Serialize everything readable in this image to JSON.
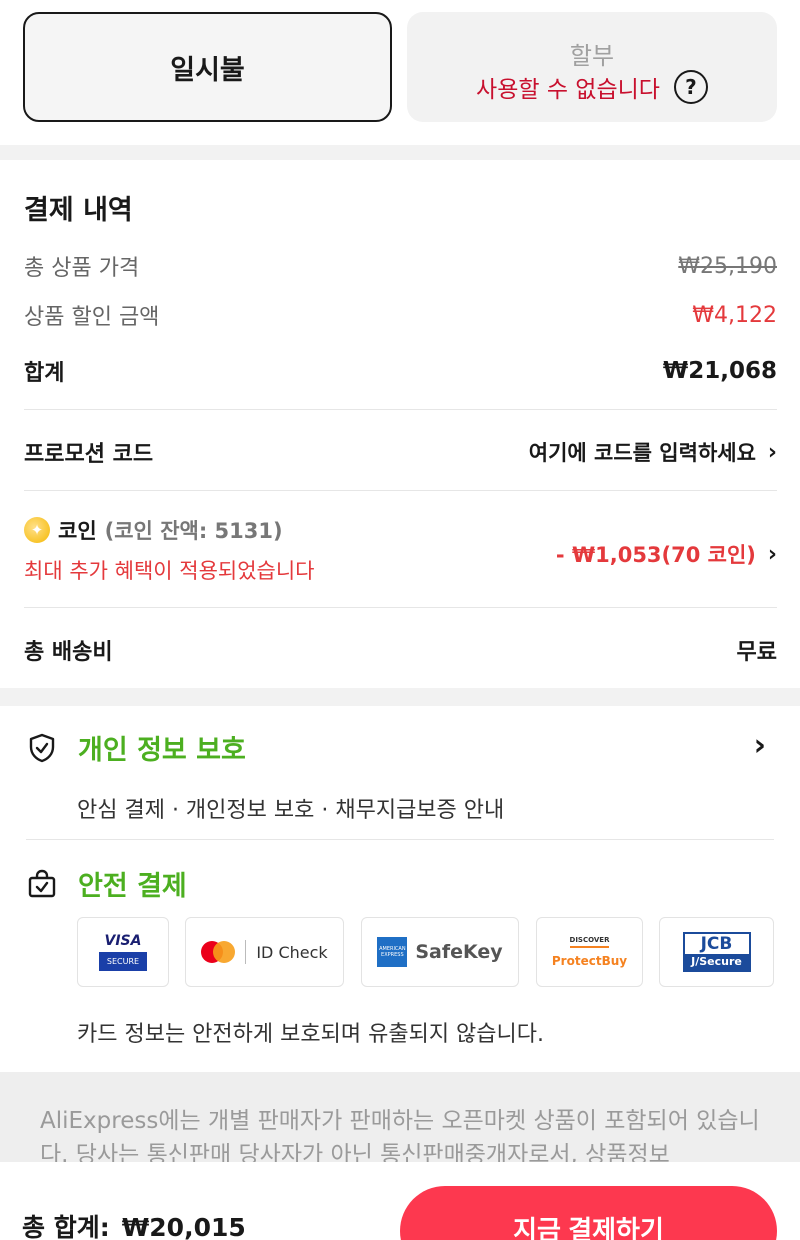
{
  "payment_type": {
    "lump_sum": "일시불",
    "installment": "할부",
    "installment_status": "사용할 수 없습니다",
    "help_icon": "question-circle-icon"
  },
  "summary": {
    "title": "결제 내역",
    "subtotal_label": "총 상품 가격",
    "subtotal_value": "₩25,190",
    "discount_label": "상품 할인 금액",
    "discount_value": "₩4,122",
    "total_label": "합계",
    "total_value": "₩21,068",
    "promo_label": "프로모션 코드",
    "promo_placeholder": "여기에 코드를 입력하세요",
    "coin_label": "코인",
    "coin_balance": "(코인 잔액: 5131)",
    "coin_note": "최대 추가 혜택이 적용되었습니다",
    "coin_value": "- ₩1,053(70 코인)",
    "shipping_label": "총 배송비",
    "shipping_value": "무료"
  },
  "privacy": {
    "title": "개인 정보 보호",
    "description": "안심 결제 · 개인정보 보호 · 채무지급보증 안내"
  },
  "secure_payment": {
    "title": "안전 결제",
    "note": "카드 정보는 안전하게 보호되며 유출되지 않습니다.",
    "badges": {
      "visa_top": "VISA",
      "visa_bottom": "SECURE",
      "mastercard": "ID Check",
      "amex_logo": "AMERICAN EXPRESS",
      "amex": "SafeKey",
      "discover_logo": "DISCOVER",
      "discover": "ProtectBuy",
      "jcb_top": "JCB",
      "jcb_bottom": "J/Secure"
    }
  },
  "disclaimer": {
    "text": "AliExpress에는 개별 판매자가 판매하는 오픈마켓 상품이 포함되어 있습니다. 당사는 통신판매 당사자가 아닌 통신판매중개자로서, 상품정보"
  },
  "footer": {
    "total_label": "총 합계:",
    "total_value": "₩20,015",
    "pay_button": "지금 결제하기"
  },
  "colors": {
    "accent_red": "#fd384f",
    "discount_red": "#e4393c",
    "success_green": "#4caf20"
  }
}
